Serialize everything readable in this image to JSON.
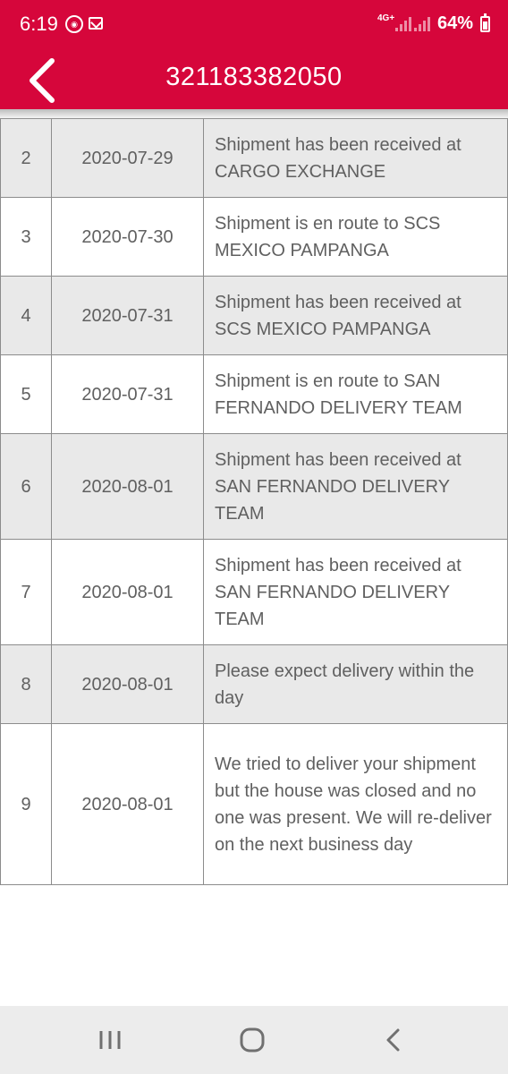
{
  "status_bar": {
    "time": "6:19",
    "app_icon_1": "game-app-icon",
    "app_icon_2": "mail-notification-icon",
    "network": "4G+",
    "battery": "64%"
  },
  "app_bar": {
    "back_icon": "chevron-left-icon",
    "title": "321183382050",
    "color": "#d6063b"
  },
  "tracking_rows": [
    {
      "num": "2",
      "date": "2020-07-29",
      "desc": "Shipment has been received at CARGO EXCHANGE"
    },
    {
      "num": "3",
      "date": "2020-07-30",
      "desc": "Shipment is en route to SCS MEXICO PAMPANGA"
    },
    {
      "num": "4",
      "date": "2020-07-31",
      "desc": "Shipment has been received at SCS MEXICO PAMPANGA"
    },
    {
      "num": "5",
      "date": "2020-07-31",
      "desc": "Shipment is en route to SAN FERNANDO DELIVERY TEAM"
    },
    {
      "num": "6",
      "date": "2020-08-01",
      "desc": "Shipment has been received at SAN FERNANDO DELIVERY TEAM"
    },
    {
      "num": "7",
      "date": "2020-08-01",
      "desc": "Shipment has been received at SAN FERNANDO DELIVERY TEAM"
    },
    {
      "num": "8",
      "date": "2020-08-01",
      "desc": "Please expect delivery within the day"
    },
    {
      "num": "9",
      "date": "2020-08-01",
      "desc": "We tried to deliver your shipment but the house was closed and no one was present. We will re-deliver on the next business day"
    }
  ],
  "nav_bar": {
    "recents_icon": "recents-icon",
    "home_icon": "home-icon",
    "back_icon": "back-icon"
  }
}
